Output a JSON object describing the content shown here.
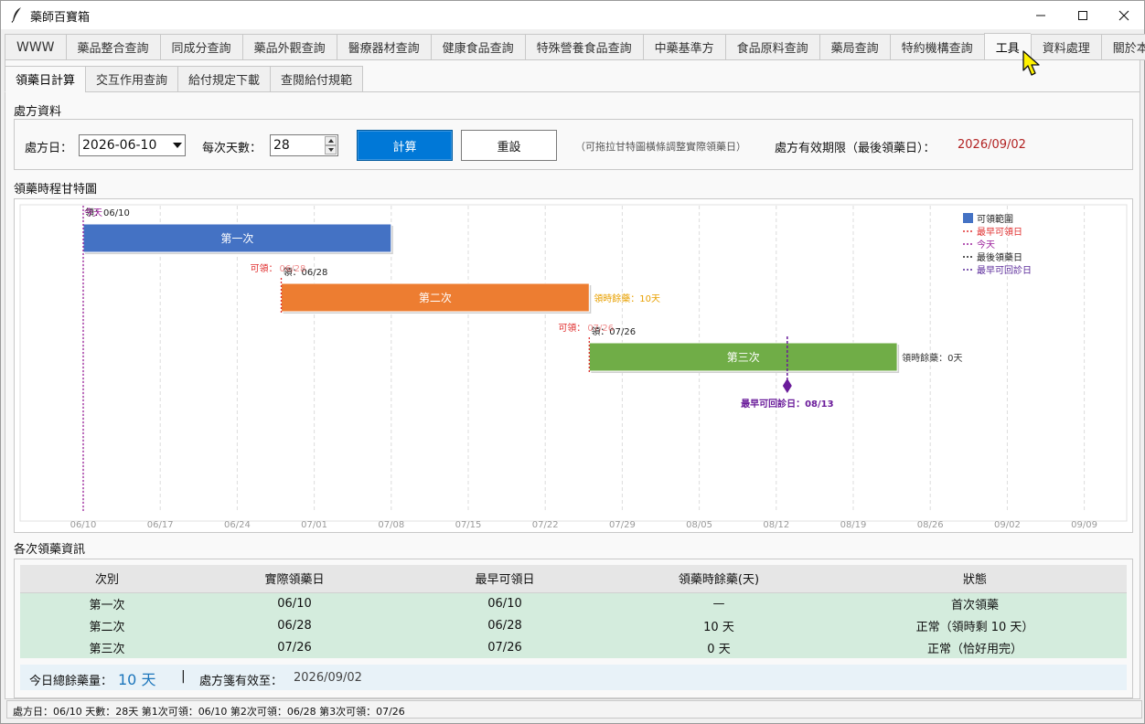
{
  "window": {
    "title": "藥師百寶箱",
    "minimize_icon": "minimize-icon",
    "maximize_icon": "maximize-icon",
    "close_icon": "close-icon"
  },
  "main_tabs": [
    {
      "label": "WWW"
    },
    {
      "label": "藥品整合查詢"
    },
    {
      "label": "同成分查詢"
    },
    {
      "label": "藥品外觀查詢"
    },
    {
      "label": "醫療器材查詢"
    },
    {
      "label": "健康食品查詢"
    },
    {
      "label": "特殊營養食品查詢"
    },
    {
      "label": "中藥基準方"
    },
    {
      "label": "食品原料查詢"
    },
    {
      "label": "藥局查詢"
    },
    {
      "label": "特約機構查詢"
    },
    {
      "label": "工具",
      "active": true
    },
    {
      "label": "資料處理"
    },
    {
      "label": "關於本程式"
    }
  ],
  "sub_tabs": [
    {
      "label": "領藥日計算",
      "active": true
    },
    {
      "label": "交互作用查詢"
    },
    {
      "label": "給付規定下載"
    },
    {
      "label": "查閱給付規範"
    }
  ],
  "prescription": {
    "section_title": "處方資料",
    "date_label": "處方日：",
    "date_value": "2026-06-10",
    "days_label": "每次天數：",
    "days_value": "28",
    "calc_button": "計算",
    "reset_button": "重設",
    "hint": "（可拖拉甘特圖橫條調整實際領藥日）",
    "expiry_label": "處方有效期限（最後領藥日）：",
    "expiry_value": "2026/09/02"
  },
  "gantt": {
    "section_title": "領藥時程甘特圖",
    "x_ticks": [
      "06/10",
      "06/17",
      "06/24",
      "07/01",
      "07/08",
      "07/15",
      "07/22",
      "07/29",
      "08/05",
      "08/12",
      "08/19",
      "08/26",
      "09/02",
      "09/09"
    ],
    "bars": [
      {
        "label": "第一次",
        "start": "06/10",
        "end": "07/08",
        "color": "#4472c4",
        "top_label": "領：06/10",
        "early_label": "",
        "remain_label": ""
      },
      {
        "label": "第二次",
        "start": "06/28",
        "end": "07/26",
        "color": "#ed7d31",
        "top_label": "領：06/28",
        "early_label": "可領：06/28",
        "remain_label": "領時餘藥：10天"
      },
      {
        "label": "第三次",
        "start": "07/26",
        "end": "08/23",
        "color": "#70ad47",
        "top_label": "領：07/26",
        "early_label": "可領：07/26",
        "remain_label": "領時餘藥：0天"
      }
    ],
    "today_label": "今天",
    "today": "06/10",
    "revisit_label": "最早可回診日：08/13",
    "revisit_date": "08/13",
    "legend": [
      {
        "label": "可領範圍",
        "kind": "box",
        "color": "#4472c4"
      },
      {
        "label": "最早可領日",
        "kind": "dot",
        "color": "#e03030"
      },
      {
        "label": "今天",
        "kind": "dot",
        "color": "#9b1f9b"
      },
      {
        "label": "最後領藥日",
        "kind": "dot",
        "color": "#222222"
      },
      {
        "label": "最早可回診日",
        "kind": "dot",
        "color": "#5a2a9a"
      }
    ],
    "colors": {
      "remain_orange": "#e8a000",
      "revisit": "#6a1b9a",
      "early": "#e03030"
    }
  },
  "info_table": {
    "section_title": "各次領藥資訊",
    "headers": [
      "次別",
      "實際領藥日",
      "最早可領日",
      "領藥時餘藥(天)",
      "狀態"
    ],
    "rows": [
      [
        "第一次",
        "06/10",
        "06/10",
        "—",
        "首次領藥"
      ],
      [
        "第二次",
        "06/28",
        "06/28",
        "10 天",
        "正常（領時剩 10 天）"
      ],
      [
        "第三次",
        "07/26",
        "07/26",
        "0 天",
        "正常（恰好用完）"
      ]
    ],
    "summary_label": "今日總餘藥量：",
    "summary_value": "10 天",
    "separator": "|",
    "expiry_label": "處方箋有效至：",
    "expiry_value": "2026/09/02"
  },
  "statusbar": {
    "text": "處方日：06/10  天數：28天  第1次可領：06/10  第2次可領：06/28  第3次可領：07/26"
  }
}
